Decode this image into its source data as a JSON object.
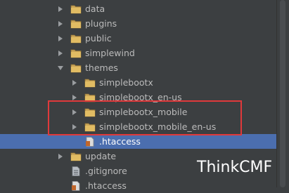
{
  "tree": {
    "items": [
      {
        "label": "data",
        "type": "folder",
        "arrow": "right"
      },
      {
        "label": "plugins",
        "type": "folder",
        "arrow": "right"
      },
      {
        "label": "public",
        "type": "folder",
        "arrow": "right"
      },
      {
        "label": "simplewind",
        "type": "folder",
        "arrow": "right"
      },
      {
        "label": "themes",
        "type": "folder",
        "arrow": "down"
      },
      {
        "label": "simplebootx",
        "type": "folder",
        "arrow": "right"
      },
      {
        "label": "simplebootx_en-us",
        "type": "folder",
        "arrow": "right"
      },
      {
        "label": "simplebootx_mobile",
        "type": "folder",
        "arrow": "right"
      },
      {
        "label": "simplebootx_mobile_en-us",
        "type": "folder",
        "arrow": "right"
      },
      {
        "label": ".htaccess",
        "type": "file",
        "arrow": "none",
        "selected": true
      },
      {
        "label": "update",
        "type": "folder",
        "arrow": "right"
      },
      {
        "label": ".gitignore",
        "type": "file",
        "arrow": "none"
      },
      {
        "label": ".htaccess",
        "type": "file",
        "arrow": "none"
      }
    ]
  },
  "watermark": "ThinkCMF",
  "colors": {
    "background": "#3c3f41",
    "selection": "#4b6eaf",
    "folder": "#c9a456",
    "highlight_box": "#e0393b"
  },
  "icons": {
    "folder": "folder-icon",
    "file": "file-icon"
  }
}
